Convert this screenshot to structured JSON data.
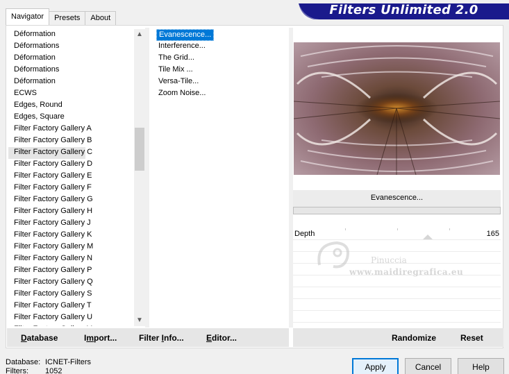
{
  "tabs": [
    "Navigator",
    "Presets",
    "About"
  ],
  "banner_title": "Filters Unlimited 2.0",
  "categories": [
    "Déformation",
    "Déformations",
    "Déformation",
    "Déformations",
    "Déformation",
    "ECWS",
    "Edges, Round",
    "Edges, Square",
    "Filter Factory Gallery A",
    "Filter Factory Gallery B",
    "Filter Factory Gallery C",
    "Filter Factory Gallery D",
    "Filter Factory Gallery E",
    "Filter Factory Gallery F",
    "Filter Factory Gallery G",
    "Filter Factory Gallery H",
    "Filter Factory Gallery J",
    "Filter Factory Gallery K",
    "Filter Factory Gallery M",
    "Filter Factory Gallery N",
    "Filter Factory Gallery P",
    "Filter Factory Gallery Q",
    "Filter Factory Gallery S",
    "Filter Factory Gallery T",
    "Filter Factory Gallery U",
    "Filter Factory Gallery V"
  ],
  "selected_category": "Filter Factory Gallery C",
  "filters": [
    "Evanescence...",
    "Interference...",
    "The Grid...",
    "Tile Mix ...",
    "Versa-Tile...",
    "Zoom Noise..."
  ],
  "selected_filter": "Evanescence...",
  "current_filter_name": "Evanescence...",
  "parameter": {
    "label": "Depth",
    "value": "165"
  },
  "watermark": {
    "name": "Pinuccia",
    "url": "www.maidiregrafica.eu"
  },
  "bottom_left_buttons": {
    "database": {
      "u": "D",
      "rest": "atabase"
    },
    "import": {
      "pre": "I",
      "u": "m",
      "rest": "port..."
    },
    "filter_info": {
      "pre": "Filter ",
      "u": "I",
      "rest": "nfo..."
    },
    "editor": {
      "u": "E",
      "rest": "ditor..."
    }
  },
  "bottom_right_buttons": {
    "randomize": "Randomize",
    "reset": "Reset"
  },
  "status": {
    "database_label": "Database:",
    "database_value": "ICNET-Filters",
    "filters_label": "Filters:",
    "filters_value": "1052"
  },
  "dialog_buttons": {
    "apply": "Apply",
    "cancel": "Cancel",
    "help": "Help"
  },
  "colors": {
    "banner": "#1a1a8c",
    "selection": "#0078d7"
  }
}
